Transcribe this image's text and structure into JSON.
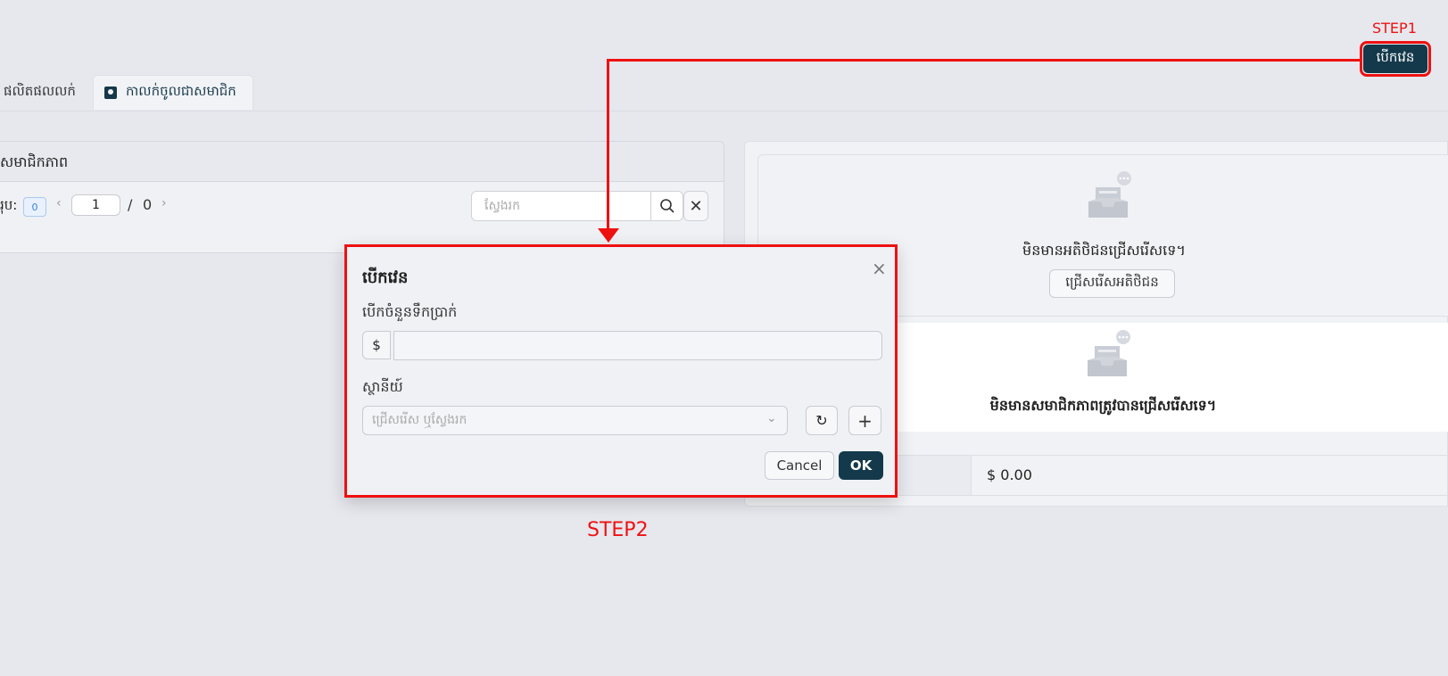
{
  "tabs": [
    {
      "label": "ផលិតផលលក់"
    },
    {
      "label": "កាលក់ចូលជាសមាជិក"
    }
  ],
  "left_panel": {
    "title": "សមាជិកភាព",
    "count_label": "រុប:",
    "count": "0",
    "pagination": {
      "page": "1",
      "separator": "/",
      "total": "0",
      "prev": "‹",
      "next": "›"
    },
    "search_placeholder": "ស្វែងរក",
    "clear_symbol": "✕"
  },
  "right_panel": {
    "customer_empty": "មិនមានអតិថិជនជ្រើសរើសទេ។",
    "choose_customer": "ជ្រើសរើសអតិថិជន",
    "member_empty": "មិនមានសមាជិកភាពត្រូវបានជ្រើសរើសទេ។",
    "total_value": "$ 0.00"
  },
  "annotations": {
    "step1": "STEP1",
    "step2": "STEP2",
    "color": "#ee1111"
  },
  "toolbar": {
    "open_shift": "បើកវេន"
  },
  "dialog": {
    "title": "បើកវេន",
    "close_symbol": "×",
    "amount_label": "បើកចំនួនទឹកប្រាក់",
    "currency_prefix": "$",
    "amount_value": "",
    "station_label": "ស្ថានីយ៍",
    "station_placeholder": "ជ្រើសរើស ឬស្វែងរក",
    "refresh_symbol": "↻",
    "add_symbol": "+",
    "cancel": "Cancel",
    "ok": "OK"
  },
  "colors": {
    "primary": "#14394b",
    "background": "#e6e8ee"
  }
}
